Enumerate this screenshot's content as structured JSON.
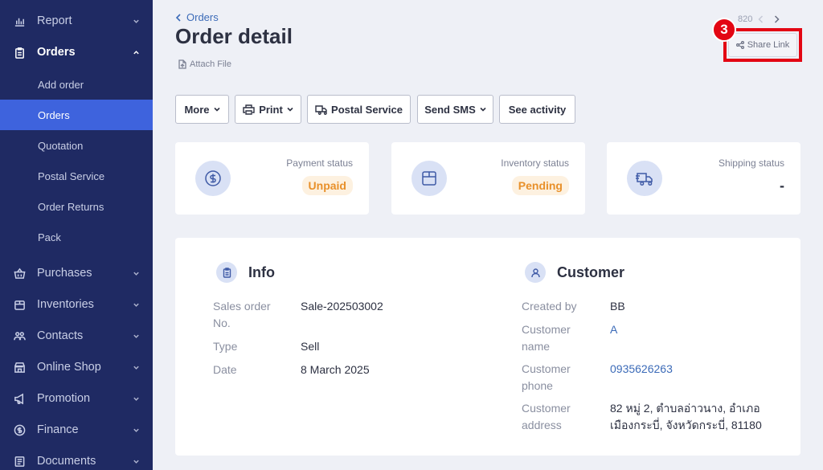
{
  "sidebar": {
    "items": [
      {
        "label": "Report",
        "icon": "bar-chart-icon"
      },
      {
        "label": "Orders",
        "icon": "clipboard-icon"
      },
      {
        "label": "Purchases",
        "icon": "basket-icon"
      },
      {
        "label": "Inventories",
        "icon": "box-icon"
      },
      {
        "label": "Contacts",
        "icon": "people-icon"
      },
      {
        "label": "Online Shop",
        "icon": "shop-icon"
      },
      {
        "label": "Promotion",
        "icon": "megaphone-icon"
      },
      {
        "label": "Finance",
        "icon": "coin-icon"
      },
      {
        "label": "Documents",
        "icon": "document-icon"
      }
    ],
    "orders_sub": [
      "Add order",
      "Orders",
      "Quotation",
      "Postal Service",
      "Order Returns",
      "Pack"
    ],
    "selected_sub": "Orders"
  },
  "header": {
    "breadcrumb": "Orders",
    "title": "Order detail",
    "attach_label": "Attach File",
    "pager_text": "820",
    "share_label": "Share Link",
    "step_number": "3"
  },
  "toolbar": {
    "more": "More",
    "print": "Print",
    "postal": "Postal Service",
    "sms": "Send SMS",
    "activity": "See activity"
  },
  "status": {
    "payment": {
      "label": "Payment status",
      "value": "Unpaid"
    },
    "inventory": {
      "label": "Inventory status",
      "value": "Pending"
    },
    "shipping": {
      "label": "Shipping status",
      "value": "-"
    }
  },
  "info": {
    "title": "Info",
    "fields": [
      {
        "key": "Sales order No.",
        "value": "Sale-202503002"
      },
      {
        "key": "Type",
        "value": "Sell"
      },
      {
        "key": "Date",
        "value": "8 March 2025"
      }
    ]
  },
  "customer": {
    "title": "Customer",
    "fields": [
      {
        "key": "Created by",
        "value": "BB"
      },
      {
        "key": "Customer name",
        "value": "A"
      },
      {
        "key": "Customer phone",
        "value": "0935626263"
      },
      {
        "key": "Customer address",
        "value": "82 หมู่ 2, ตำบลอ่าวนาง, อำเภอเมืองกระบี่, จังหวัดกระบี่, 81180"
      }
    ]
  },
  "colors": {
    "sidebar_bg": "#1f2a63",
    "selected_bg": "#3e63dd",
    "link": "#3c6bb8",
    "pending_orange": "#e8902a",
    "highlight_red": "#e30613"
  }
}
